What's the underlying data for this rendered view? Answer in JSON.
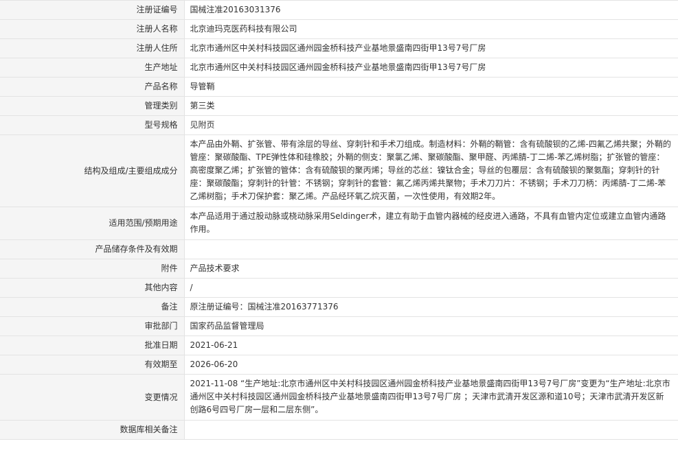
{
  "rows": [
    {
      "label": "注册证编号",
      "value": "国械注准20163031376"
    },
    {
      "label": "注册人名称",
      "value": "北京迪玛克医药科技有限公司"
    },
    {
      "label": "注册人住所",
      "value": "北京市通州区中关村科技园区通州园金桥科技产业基地景盛南四街甲13号7号厂房"
    },
    {
      "label": "生产地址",
      "value": "北京市通州区中关村科技园区通州园金桥科技产业基地景盛南四街甲13号7号厂房"
    },
    {
      "label": "产品名称",
      "value": "导管鞘"
    },
    {
      "label": "管理类别",
      "value": "第三类"
    },
    {
      "label": "型号规格",
      "value": "见附页"
    },
    {
      "label": "结构及组成/主要组成成分",
      "value": "本产品由外鞘、扩张管、带有涂层的导丝、穿刺针和手术刀组成。制造材料：外鞘的鞘管：含有硫酸钡的乙烯-四氟乙烯共聚；外鞘的管座：聚碳酸酯、TPE弹性体和硅橡胶；外鞘的侧支：聚氯乙烯、聚碳酸酯、聚甲醛、丙烯腈-丁二烯-苯乙烯树脂；扩张管的管座：高密度聚乙烯；扩张管的管体：含有硫酸钡的聚丙烯；导丝的芯丝：镍钛合金；导丝的包覆层：含有硫酸钡的聚氨酯；穿刺针的针座：聚碳酸酯；穿刺针的针管：不锈钢；穿刺针的套管：氟乙烯丙烯共聚物；手术刀刀片：不锈钢；手术刀刀柄：丙烯腈-丁二烯-苯乙烯树脂；手术刀保护套：聚乙烯。产品经环氧乙烷灭菌，一次性使用，有效期2年。"
    },
    {
      "label": "适用范围/预期用途",
      "value": "本产品适用于通过股动脉或桡动脉采用Seldinger术，建立有助于血管内器械的经皮进入通路，不具有血管内定位或建立血管内通路作用。"
    },
    {
      "label": "产品储存条件及有效期",
      "value": ""
    },
    {
      "label": "附件",
      "value": "产品技术要求"
    },
    {
      "label": "其他内容",
      "value": "/"
    },
    {
      "label": "备注",
      "value": "原注册证编号：国械注准20163771376"
    },
    {
      "label": "审批部门",
      "value": "国家药品监督管理局"
    },
    {
      "label": "批准日期",
      "value": "2021-06-21"
    },
    {
      "label": "有效期至",
      "value": "2026-06-20"
    },
    {
      "label": "变更情况",
      "value": "2021-11-08 “生产地址:北京市通州区中关村科技园区通州园金桥科技产业基地景盛南四街甲13号7号厂房”变更为“生产地址:北京市通州区中关村科技园区通州园金桥科技产业基地景盛南四街甲13号7号厂房 ；天津市武清开发区源和道10号；天津市武清开发区新创路6号四号厂房一层和二层东侧”。"
    },
    {
      "label": "数据库相关备注",
      "value": ""
    }
  ]
}
